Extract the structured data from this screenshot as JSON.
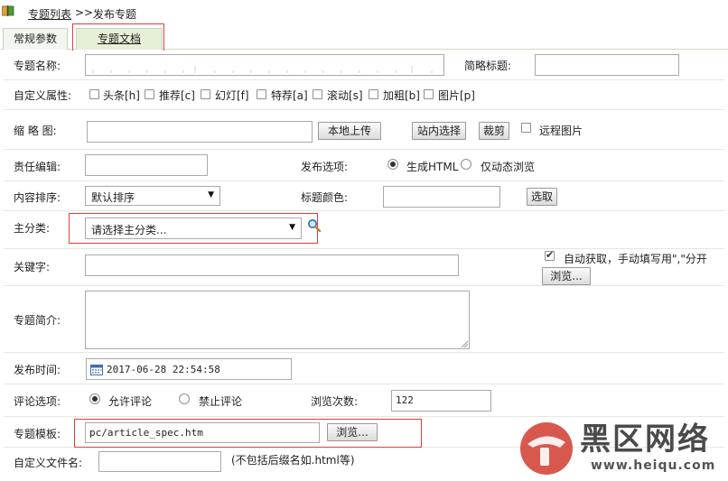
{
  "breadcrumb": {
    "parent": "专题列表",
    "separator": ">>",
    "current": "发布专题"
  },
  "tabs": [
    {
      "label": "常规参数"
    },
    {
      "label": "专题文档"
    }
  ],
  "form": {
    "title_label": "专题名称:",
    "short_title_label": "简略标题:",
    "flags_label": "自定义属性:",
    "flags": [
      "头条[h]",
      "推荐[c]",
      "幻灯[f]",
      "特荐[a]",
      "滚动[s]",
      "加粗[b]",
      "图片[p]"
    ],
    "thumb_label": "缩 略 图:",
    "upload_button": "本地上传",
    "site_select_button": "站内选择",
    "crop_button": "裁剪",
    "remote_image_label": "远程图片",
    "editor_label": "责任编辑:",
    "publish_option_label": "发布选项:",
    "publish_options": [
      "生成HTML",
      "仅动态浏览"
    ],
    "sort_label": "内容排序:",
    "sort_value": "默认排序",
    "title_color_label": "标题颜色:",
    "pick_button": "选取",
    "main_category_label": "主分类:",
    "main_category_value": "请选择主分类...",
    "keywords_label": "关键字:",
    "auto_keywords_label": "自动获取，手动填写用\",\"分开",
    "browse_button_1": "浏览...",
    "summary_label": "专题简介:",
    "publish_time_label": "发布时间:",
    "publish_time_value": "2017-06-28 22:54:58",
    "comment_label": "评论选项:",
    "comment_options": [
      "允许评论",
      "禁止评论"
    ],
    "views_label": "浏览次数:",
    "views_value": "122",
    "template_label": "专题模板:",
    "template_value": "pc/article_spec.htm",
    "browse_button_2": "浏览...",
    "filename_label": "自定义文件名:",
    "filename_hint": "(不包括后缀名如.html等)"
  },
  "watermark": {
    "text": "黑区网络",
    "url": "www.heiqu.com"
  }
}
